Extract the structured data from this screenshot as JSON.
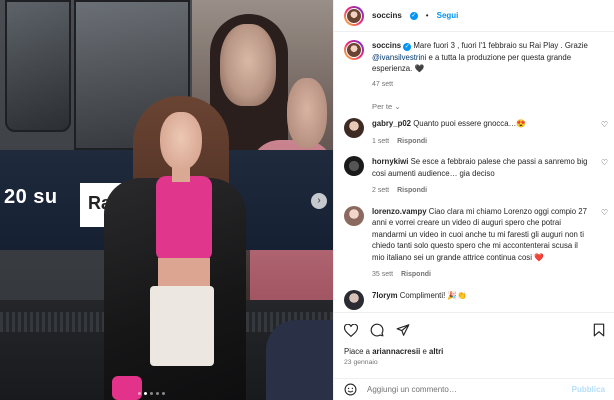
{
  "colors": {
    "accent": "#0095f6",
    "muted": "#737373",
    "text": "#262626",
    "heart_red": "#ed4956"
  },
  "photo": {
    "train_text": "20 su",
    "logo_text": "Ra",
    "carousel_dots": 5,
    "active_dot": 1
  },
  "header": {
    "username": "soccins",
    "separator": "•",
    "follow_label": "Segui"
  },
  "caption": {
    "username": "soccins",
    "text_part1": "Mare fuori 3 , fuori l'1 febbraio su Rai Play . Grazie ",
    "mention": "@ivansilvestrini",
    "text_part2": " e a tutta la produzione per questa grande esperienza. 🖤",
    "time": "47 sett"
  },
  "filter_label": "Per te ⌄",
  "comments": [
    {
      "username": "gabry_p02",
      "text": "Quanto puoi essere gnocca…😍",
      "time": "1 sett",
      "reply": "Rispondi"
    },
    {
      "username": "hornykiwi",
      "text": "Se esce a febbraio palese che passi a sanremo big cosi aumenti audience… gia deciso",
      "time": "2 sett",
      "reply": "Rispondi"
    },
    {
      "username": "lorenzo.vampy",
      "text": "Ciao clara mi chiamo Lorenzo oggi compio 27 anni e vorrei creare un video di auguri spero che potrai mandarmi un video in cuoi anche tu mi faresti gli auguri non ti chiedo tanti solo questo spero che mi accontenterai scusa il mio italiano sei un grande attrice continua cosi ❤️",
      "time": "35 sett",
      "reply": "Rispondi"
    },
    {
      "username": "7lorym",
      "text": "Complimenti! 🎉👏",
      "time": "",
      "reply": ""
    }
  ],
  "actions": {
    "likes_prefix": "Piace a ",
    "likes_user": "ariannacresii",
    "likes_mid": " e ",
    "likes_others": "altri",
    "date": "23 gennaio"
  },
  "add_comment": {
    "placeholder": "Aggiungi un commento…",
    "publish_label": "Pubblica"
  }
}
